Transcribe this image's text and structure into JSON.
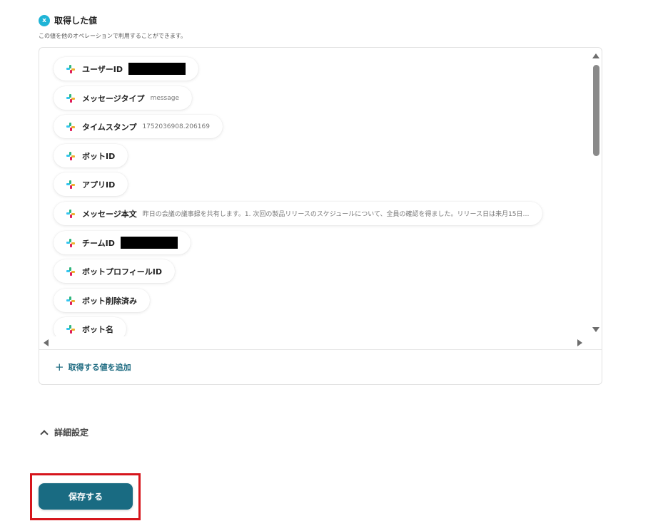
{
  "header": {
    "icon": "x-badge-icon",
    "title": "取得した値"
  },
  "description": "この値を他のオペレーションで利用することができます。",
  "items": [
    {
      "label": "ユーザーID",
      "value": "",
      "redacted": true
    },
    {
      "label": "メッセージタイプ",
      "value": "message",
      "redacted": false
    },
    {
      "label": "タイムスタンプ",
      "value": "1752036908.206169",
      "redacted": false
    },
    {
      "label": "ボットID",
      "value": "",
      "redacted": false
    },
    {
      "label": "アプリID",
      "value": "",
      "redacted": false
    },
    {
      "label": "メッセージ本文",
      "value": "昨日の会議の議事録を共有します。1. 次回の製品リリースのスケジュールについて、全員の確認を得ました。リリース日は来月15日…",
      "redacted": false
    },
    {
      "label": "チームID",
      "value": "",
      "redacted": true
    },
    {
      "label": "ボットプロフィールID",
      "value": "",
      "redacted": false
    },
    {
      "label": "ボット削除済み",
      "value": "",
      "redacted": false
    },
    {
      "label": "ボット名",
      "value": "",
      "redacted": false
    }
  ],
  "add_value_label": "取得する値を追加",
  "advanced_label": "詳細設定",
  "save_label": "保存する",
  "colors": {
    "accent": "#196b82",
    "highlight": "#d6151c",
    "badge": "#1fb4d6"
  }
}
